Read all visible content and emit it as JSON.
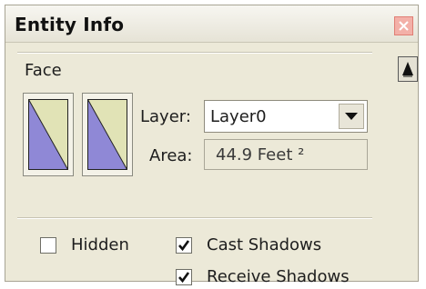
{
  "window": {
    "title": "Entity Info",
    "close_icon": "close-x-icon"
  },
  "entity": {
    "type_label": "Face",
    "expand_icon": "triangle-up-icon"
  },
  "materials": {
    "front_swatch_icon": "front-material-swatch",
    "back_swatch_icon": "back-material-swatch",
    "swatch_colors": {
      "fill": "#8f88d6",
      "paper": "#e1e3b6"
    }
  },
  "layer": {
    "label": "Layer:",
    "value": "Layer0"
  },
  "area": {
    "label": "Area:",
    "value": "44.9 Feet ²"
  },
  "options": {
    "hidden": {
      "label": "Hidden",
      "checked": false
    },
    "cast_shadows": {
      "label": "Cast Shadows",
      "checked": true
    },
    "receive_shadows": {
      "label": "Receive Shadows",
      "checked": true
    }
  }
}
